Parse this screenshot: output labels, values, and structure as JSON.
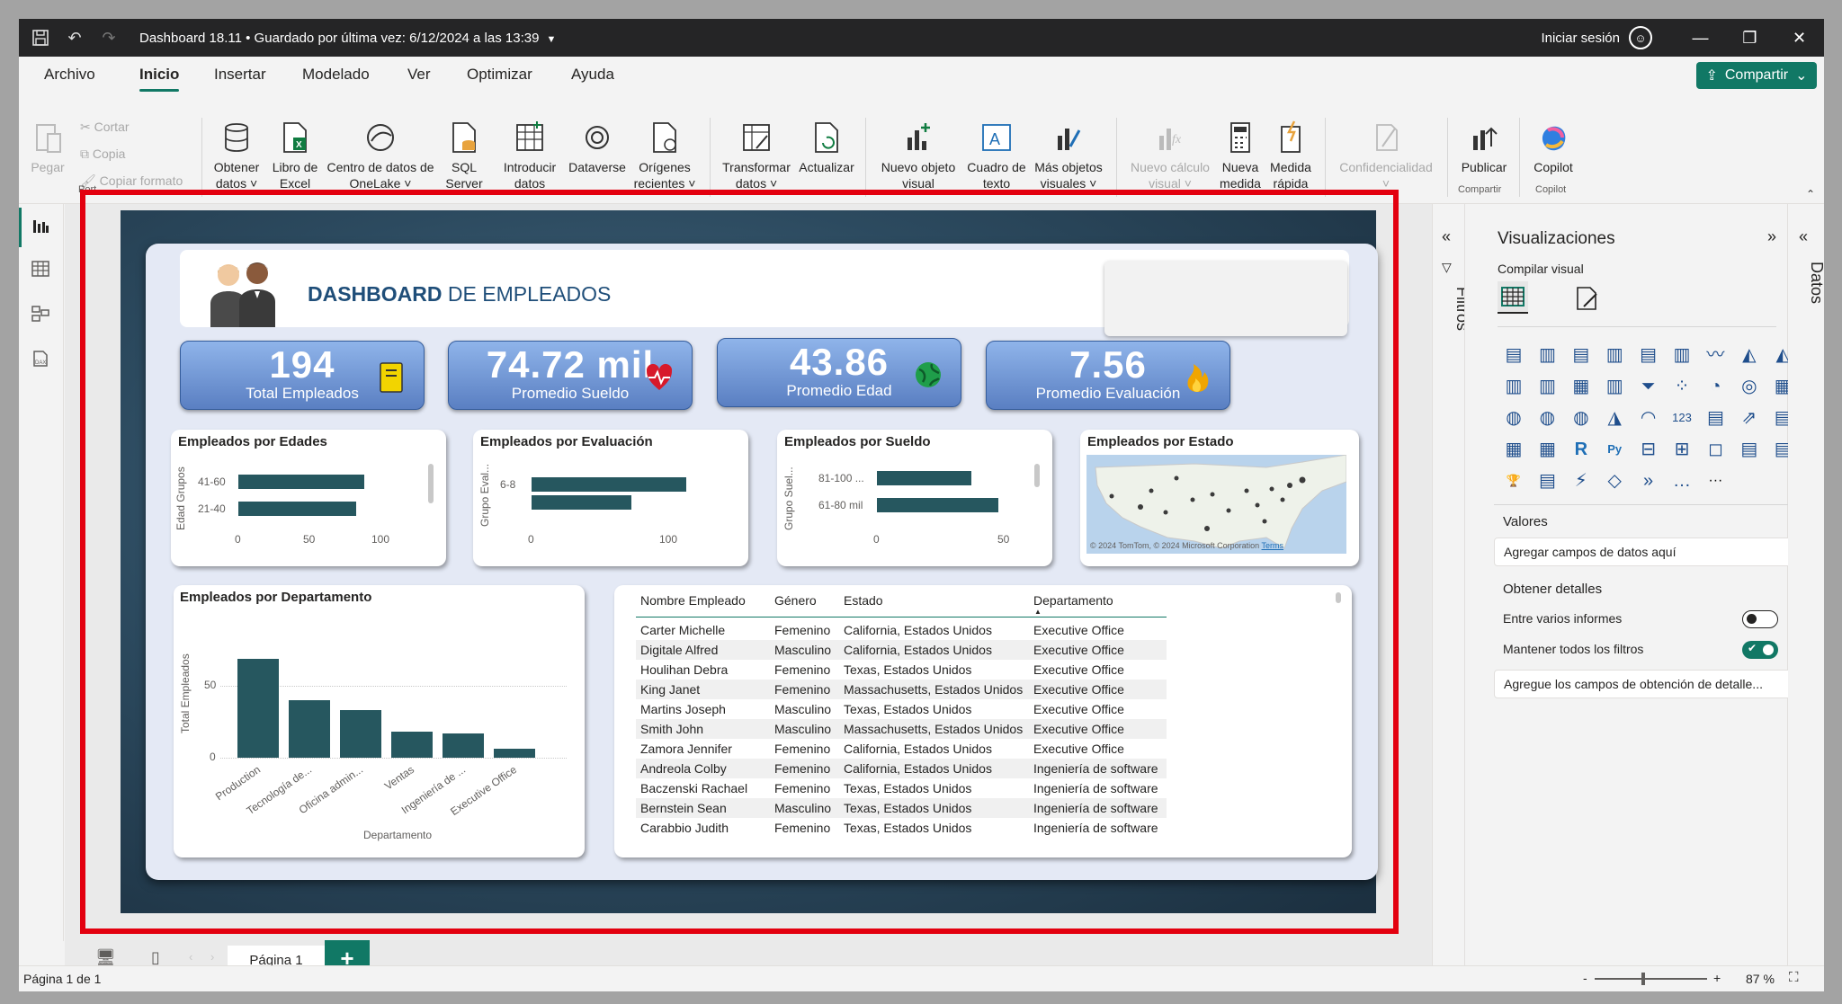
{
  "titlebar": {
    "title": "Dashboard 18.11 • Guardado por última vez: 6/12/2024 a las 13:39",
    "signin": "Iniciar sesión"
  },
  "menu": {
    "tabs": [
      "Archivo",
      "Inicio",
      "Insertar",
      "Modelado",
      "Ver",
      "Optimizar",
      "Ayuda"
    ],
    "share": "Compartir"
  },
  "ribbon": {
    "pegar": "Pegar",
    "cortar": "Cortar",
    "copia": "Copia",
    "copiar_formato": "Copiar formato",
    "obtener_datos": [
      "Obtener",
      "datos ˅"
    ],
    "libro_excel": [
      "Libro de",
      "Excel"
    ],
    "onelake": [
      "Centro de datos de",
      "OneLake ˅"
    ],
    "sql": [
      "SQL",
      "Server"
    ],
    "introducir": [
      "Introducir",
      "datos"
    ],
    "dataverse": "Dataverse",
    "origenes": [
      "Orígenes",
      "recientes ˅"
    ],
    "transformar": [
      "Transformar",
      "datos ˅"
    ],
    "actualizar": "Actualizar",
    "nuevo_objeto": [
      "Nuevo objeto",
      "visual"
    ],
    "cuadro_texto": [
      "Cuadro de",
      "texto"
    ],
    "mas_objetos": [
      "Más objetos",
      "visuales ˅"
    ],
    "nuevo_calculo": [
      "Nuevo cálculo",
      "visual ˅"
    ],
    "nueva_medida": [
      "Nueva",
      "medida"
    ],
    "medida_rapida": [
      "Medida",
      "rápida"
    ],
    "confidencialidad": "Confidencialidad",
    "publicar": "Publicar",
    "copilot": "Copilot",
    "groups": {
      "portapapeles": "Port",
      "compartir": "Compartir",
      "copilot": "Copilot"
    }
  },
  "dashboard": {
    "title_bold": "DASHBOARD",
    "title_rest": " DE EMPLEADOS",
    "kpis": [
      {
        "value": "194",
        "label": "Total Empleados",
        "icon": "notebook-icon"
      },
      {
        "value": "74.72 mil",
        "label": "Promedio Sueldo",
        "icon": "heart-icon"
      },
      {
        "value": "43.86",
        "label": "Promedio Edad",
        "icon": "globe-icon"
      },
      {
        "value": "7.56",
        "label": "Promedio Evaluación",
        "icon": "flame-icon"
      }
    ],
    "chart_edades": {
      "title": "Empleados por Edades",
      "ylabel": "Edad Grupos",
      "ticks": [
        "0",
        "50",
        "100"
      ]
    },
    "chart_evaluacion": {
      "title": "Empleados por Evaluación",
      "ylabel": "Grupo Eval...",
      "ticks": [
        "0",
        "100"
      ]
    },
    "chart_sueldo": {
      "title": "Empleados por Sueldo",
      "ylabel": "Grupo Suel...",
      "ticks": [
        "0",
        "50"
      ]
    },
    "map": {
      "title": "Empleados por Estado",
      "attribution": "© 2024 TomTom, © 2024 Microsoft Corporation",
      "terms": "Terms"
    },
    "chart_departamento": {
      "title": "Empleados por Departamento",
      "xlabel": "Departamento",
      "ylabel": "Total Empleados",
      "ticks": [
        "0",
        "50"
      ]
    },
    "table": {
      "columns": [
        "Nombre Empleado",
        "Género",
        "Estado",
        "Departamento"
      ],
      "rows": [
        [
          "Carter Michelle",
          "Femenino",
          "California, Estados Unidos",
          "Executive Office"
        ],
        [
          "Digitale Alfred",
          "Masculino",
          "California, Estados Unidos",
          "Executive Office"
        ],
        [
          "Houlihan Debra",
          "Femenino",
          "Texas, Estados Unidos",
          "Executive Office"
        ],
        [
          "King Janet",
          "Femenino",
          "Massachusetts, Estados Unidos",
          "Executive Office"
        ],
        [
          "Martins Joseph",
          "Masculino",
          "Texas, Estados Unidos",
          "Executive Office"
        ],
        [
          "Smith John",
          "Masculino",
          "Massachusetts, Estados Unidos",
          "Executive Office"
        ],
        [
          "Zamora Jennifer",
          "Femenino",
          "California, Estados Unidos",
          "Executive Office"
        ],
        [
          "Andreola Colby",
          "Femenino",
          "California, Estados Unidos",
          "Ingeniería de software"
        ],
        [
          "Baczenski Rachael",
          "Femenino",
          "Texas, Estados Unidos",
          "Ingeniería de software"
        ],
        [
          "Bernstein Sean",
          "Masculino",
          "Texas, Estados Unidos",
          "Ingeniería de software"
        ],
        [
          "Carabbio Judith",
          "Femenino",
          "Texas, Estados Unidos",
          "Ingeniería de software"
        ]
      ]
    }
  },
  "chart_data": [
    {
      "type": "bar",
      "orientation": "horizontal",
      "title": "Empleados por Edades",
      "ylabel": "Edad Grupos",
      "categories": [
        "41-60",
        "21-40"
      ],
      "values": [
        92,
        86
      ],
      "xlim": [
        0,
        100
      ]
    },
    {
      "type": "bar",
      "orientation": "horizontal",
      "title": "Empleados por Evaluación",
      "ylabel": "Grupo Eval...",
      "categories": [
        "6-8",
        ""
      ],
      "values": [
        118,
        76
      ],
      "xlim": [
        0,
        100
      ]
    },
    {
      "type": "bar",
      "orientation": "horizontal",
      "title": "Empleados por Sueldo",
      "ylabel": "Grupo Suel...",
      "categories": [
        "81-100 ...",
        "61-80 mil"
      ],
      "values": [
        38,
        49
      ],
      "xlim": [
        0,
        50
      ]
    },
    {
      "type": "bar",
      "title": "Empleados por Departamento",
      "xlabel": "Departamento",
      "ylabel": "Total Empleados",
      "categories": [
        "Production",
        "Tecnología de...",
        "Oficina admin...",
        "Ventas",
        "Ingeniería de ...",
        "Executive Office"
      ],
      "values": [
        69,
        40,
        33,
        18,
        17,
        6
      ],
      "ylim": [
        0,
        75
      ]
    }
  ],
  "pages": {
    "tab": "Página 1",
    "add": "+"
  },
  "status": {
    "page": "Página 1 de 1",
    "zoom": "87 %",
    "minus": "-",
    "plus": "+"
  },
  "filters": {
    "label": "Filtros"
  },
  "viz": {
    "title": "Visualizaciones",
    "build": "Compilar visual",
    "valores": "Valores",
    "valores_placeholder": "Agregar campos de datos aquí",
    "obtener_detalles": "Obtener detalles",
    "entre_informes": "Entre varios informes",
    "mantener_filtros": "Mantener todos los filtros",
    "detalles_placeholder": "Agregue los campos de obtención de detalle...",
    "more": "···"
  },
  "datos": {
    "label": "Datos"
  },
  "colors": {
    "accent": "#117865",
    "bar": "#26575f",
    "kpi": "#5a7fc2",
    "highlight": "#e3000f"
  }
}
